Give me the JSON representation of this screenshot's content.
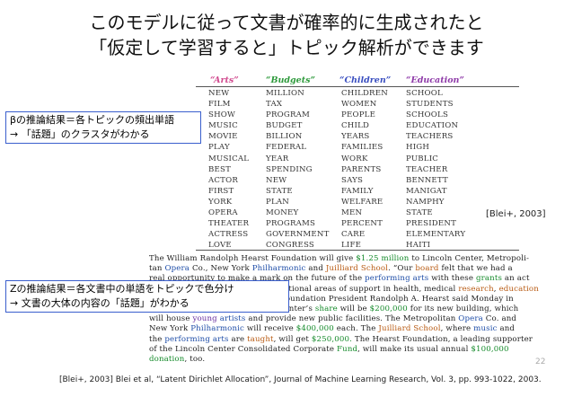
{
  "slide": {
    "title_line1": "このモデルに従って文書が確率的に生成されたと",
    "title_line2": "「仮定して学習すると」トピック解析ができます",
    "page_number": "22",
    "footer": "[Blei+, 2003] Blei et al, “Latent Dirichlet Allocation”, Journal of Machine Learning Research, Vol. 3, pp. 993-1022, 2003.",
    "citation_label": "[Blei+, 2003]"
  },
  "beta_box": {
    "line1": "βの推論結果＝各トピックの頻出単語",
    "line2": "→ 「話題」のクラスタがわかる"
  },
  "z_box": {
    "line1": "Zの推論結果＝各文書中の単語をトピックで色分け",
    "line2": "→ 文書の大体の内容の「話題」がわかる"
  },
  "topics": {
    "headers": [
      "“Arts”",
      "“Budgets”",
      "“Children”",
      "“Education”"
    ],
    "colors": [
      "#d14b8f",
      "#2e9a3c",
      "#3a4fc0",
      "#8e3aa8"
    ],
    "arts": [
      "NEW",
      "FILM",
      "SHOW",
      "MUSIC",
      "MOVIE",
      "PLAY",
      "MUSICAL",
      "BEST",
      "ACTOR",
      "FIRST",
      "YORK",
      "OPERA",
      "THEATER",
      "ACTRESS",
      "LOVE"
    ],
    "budgets": [
      "MILLION",
      "TAX",
      "PROGRAM",
      "BUDGET",
      "BILLION",
      "FEDERAL",
      "YEAR",
      "SPENDING",
      "NEW",
      "STATE",
      "PLAN",
      "MONEY",
      "PROGRAMS",
      "GOVERNMENT",
      "CONGRESS"
    ],
    "children": [
      "CHILDREN",
      "WOMEN",
      "PEOPLE",
      "CHILD",
      "YEARS",
      "FAMILIES",
      "WORK",
      "PARENTS",
      "SAYS",
      "FAMILY",
      "WELFARE",
      "MEN",
      "PERCENT",
      "CARE",
      "LIFE"
    ],
    "education": [
      "SCHOOL",
      "STUDENTS",
      "SCHOOLS",
      "EDUCATION",
      "TEACHERS",
      "HIGH",
      "PUBLIC",
      "TEACHER",
      "BENNETT",
      "MANIGAT",
      "NAMPHY",
      "STATE",
      "PRESIDENT",
      "ELEMENTARY",
      "HAITI"
    ]
  },
  "article": {
    "lines": [
      "The William Randolph Hearst Foundation will give $1.25 million to Lincoln Center, Metropoli-",
      "tan Opera Co., New York Philharmonic and Juilliard School. “Our board felt that we had a",
      "real opportunity to make a mark on the future of the performing arts with these grants an act",
      "every bit as important as our traditional areas of support in health, medical research, education",
      "and the social services,” Hearst Foundation President Randolph A. Hearst said Monday in",
      "announcing the grants. Lincoln Center’s share will be $200,000 for its new building, which",
      "will house young artists and provide new public facilities. The Metropolitan Opera Co. and",
      "New York Philharmonic will receive $400,000 each. The Juilliard School, where music and",
      "the performing arts are taught, will get $250,000. The Hearst Foundation, a leading supporter",
      "of the Lincoln Center Consolidated Corporate Fund, will make its usual annual $100,000",
      "donation, too."
    ]
  }
}
